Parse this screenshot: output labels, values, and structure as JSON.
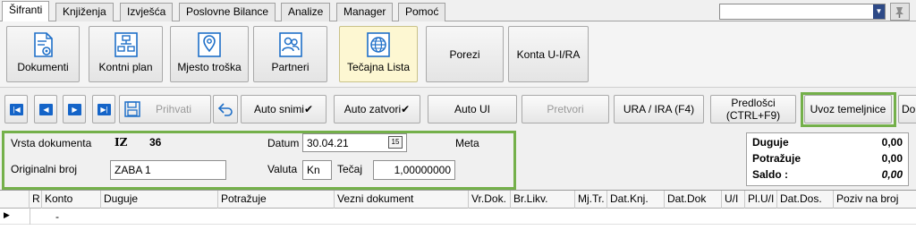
{
  "tabs": [
    {
      "label": "Šifranti",
      "active": true
    },
    {
      "label": "Knjiženja"
    },
    {
      "label": "Izvješća"
    },
    {
      "label": "Poslovne Bilance"
    },
    {
      "label": "Analize"
    },
    {
      "label": "Manager"
    },
    {
      "label": "Pomoć"
    }
  ],
  "ribbon": {
    "dokumenti": "Dokumenti",
    "kontni_plan": "Kontni plan",
    "mjesto_troska": "Mjesto troška",
    "partneri": "Partneri",
    "tecajna_lista": "Tečajna Lista",
    "porezi": "Porezi",
    "konta_ui_ira": "Konta U-I/RA"
  },
  "toolbar": {
    "prihvati": "Prihvati",
    "auto_snimi": "Auto snimi✔",
    "auto_zatvori": "Auto zatvori✔",
    "auto_ui": "Auto UI",
    "pretvori": "Pretvori",
    "ura_ira": "URA / IRA  (F4)",
    "predlosci_line1": "Predlošci",
    "predlosci_line2": "(CTRL+F9)",
    "uvoz_temeljnice": "Uvoz temeljnice",
    "overflow": "Do"
  },
  "header": {
    "vrsta_label": "Vrsta dokumenta",
    "vrsta_code": "IZ",
    "vrsta_number": "36",
    "datum_label": "Datum",
    "datum_value": "30.04.21",
    "calendar_icon_text": "15",
    "meta_label": "Meta",
    "originalni_label": "Originalni broj",
    "originalni_value": "ZABA 1",
    "valuta_label": "Valuta",
    "valuta_value": "Kn",
    "tecaj_label": "Tečaj",
    "tecaj_value": "1,00000000"
  },
  "saldo": {
    "duguje_label": "Duguje",
    "duguje_value": "0,00",
    "potrazuje_label": "Potražuje",
    "potrazuje_value": "0,00",
    "saldo_label": "Saldo  :",
    "saldo_value": "0,00"
  },
  "grid": {
    "columns": [
      "R",
      "Konto",
      "Duguje",
      "Potražuje",
      "Vezni dokument",
      "Vr.Dok.",
      "Br.Likv.",
      "Mj.Tr.",
      "Dat.Knj.",
      "Dat.Dok",
      "U/I",
      "Pl.U/I",
      "Dat.Dos.",
      "Poziv na broj"
    ],
    "row_konto": "-"
  },
  "colors": {
    "accent_green": "#74b04a",
    "nav_blue": "#1464c8",
    "ribbon_selected": "#fdf7d2"
  },
  "icons": [
    "document-gear-icon",
    "org-chart-icon",
    "map-pin-icon",
    "users-icon",
    "globe-currency-icon",
    "save-icon",
    "undo-arrow-icon",
    "calendar-icon",
    "pin-icon"
  ]
}
